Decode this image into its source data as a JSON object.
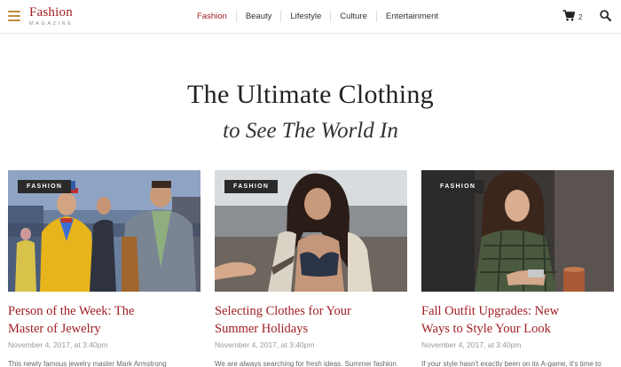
{
  "header": {
    "logo_main": "Fashion",
    "logo_sub": "MAGAZINE",
    "nav": [
      "Fashion",
      "Beauty",
      "Lifestyle",
      "Culture",
      "Entertainment"
    ],
    "active_nav": "Fashion",
    "cart_count": "2"
  },
  "hero": {
    "line1": "The Ultimate Clothing",
    "line2": "to See The World In"
  },
  "cards": [
    {
      "category": "FASHION",
      "title_line1": "Person of the Week: The",
      "title_line2": "Master of Jewelry",
      "date": "November 4, 2017, at 3:40pm",
      "excerpt": "This newly famous jewelry master Mark Armstrong"
    },
    {
      "category": "FASHION",
      "title_line1": "Selecting Clothes for Your",
      "title_line2": "Summer Holidays",
      "date": "November 4, 2017, at 3:40pm",
      "excerpt": "We are always searching for fresh ideas. Summer fashion"
    },
    {
      "category": "FASHION",
      "title_line1": "Fall Outfit Upgrades: New",
      "title_line2": "Ways to Style Your Look",
      "date": "November 4, 2017, at 3:40pm",
      "excerpt": "If your style hasn't exactly been on its A-game, it's time to"
    }
  ],
  "colors": {
    "brand": "#a01e24",
    "accent_menu": "#c08a3a",
    "badge_bg": "#2a2a2a"
  }
}
